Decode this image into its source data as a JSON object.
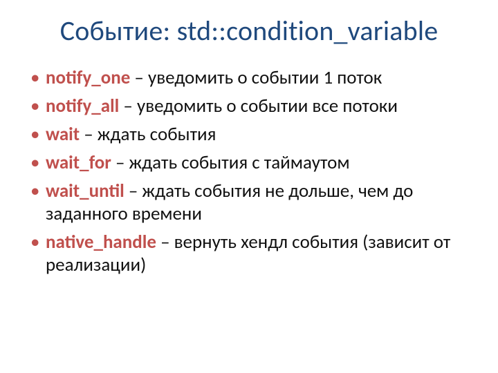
{
  "title": "Событие: std::condition_variable",
  "items": [
    {
      "term": "notify_one",
      "desc": " – уведомить о событии 1 поток"
    },
    {
      "term": "notify_all",
      "desc": " – уведомить о событии все потоки"
    },
    {
      "term": "wait",
      "desc": " – ждать события"
    },
    {
      "term": "wait_for",
      "desc": " – ждать события с таймаутом"
    },
    {
      "term": "wait_until",
      "desc": " – ждать события не дольше, чем до заданного времени"
    },
    {
      "term": "native_handle",
      "desc": " – вернуть хендл события (зависит от реализации)"
    }
  ]
}
